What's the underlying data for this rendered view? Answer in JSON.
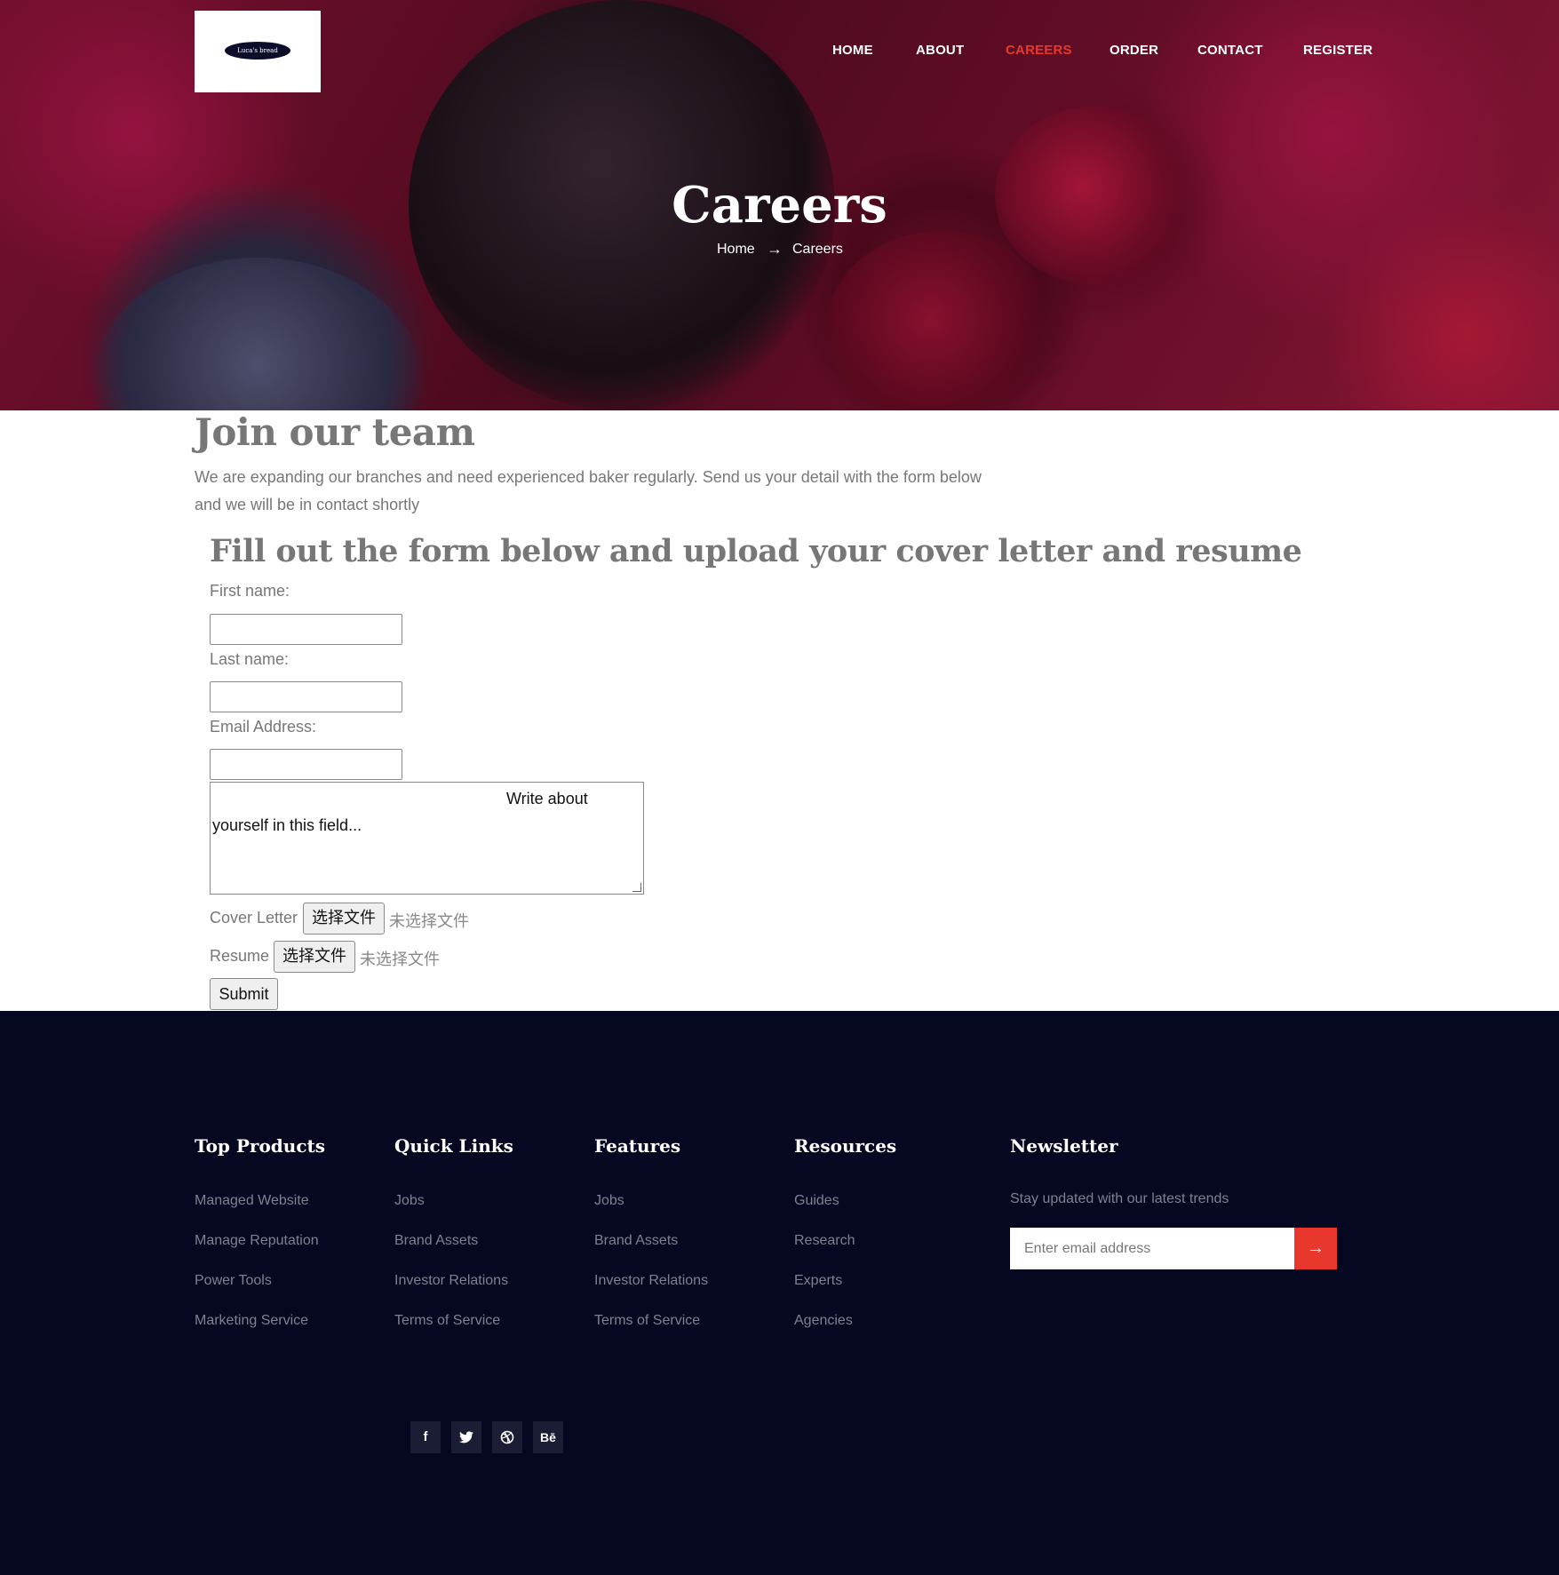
{
  "brand": {
    "logo_text": "Luca's bread"
  },
  "nav": {
    "items": [
      "HOME",
      "ABOUT",
      "CAREERS",
      "ORDER",
      "CONTACT",
      "REGISTER"
    ],
    "active": "CAREERS",
    "active_color": "#e8382e"
  },
  "hero": {
    "title": "Careers",
    "breadcrumb": {
      "home": "Home",
      "current": "Careers"
    }
  },
  "intro": {
    "heading": "Join our team",
    "text": "We are expanding our branches and need experienced baker regularly. Send us your detail with the form below and we will be in contact shortly"
  },
  "form": {
    "heading": "Fill out the form below and upload your cover letter and resume",
    "first_name_label": "First name:",
    "last_name_label": "Last name:",
    "email_label": "Email Address:",
    "about_placeholder_line1": "Write about",
    "about_placeholder_line2": "yourself in this field...",
    "cover_letter_label": "Cover Letter",
    "resume_label": "Resume",
    "choose_file": "选择文件",
    "no_file": "未选择文件",
    "submit": "Submit"
  },
  "footer": {
    "columns": [
      {
        "title": "Top Products",
        "links": [
          "Managed Website",
          "Manage Reputation",
          "Power Tools",
          "Marketing Service"
        ]
      },
      {
        "title": "Quick Links",
        "links": [
          "Jobs",
          "Brand Assets",
          "Investor Relations",
          "Terms of Service"
        ]
      },
      {
        "title": "Features",
        "links": [
          "Jobs",
          "Brand Assets",
          "Investor Relations",
          "Terms of Service"
        ]
      },
      {
        "title": "Resources",
        "links": [
          "Guides",
          "Research",
          "Experts",
          "Agencies"
        ]
      }
    ],
    "newsletter": {
      "title": "Newsletter",
      "text": "Stay updated with our latest trends",
      "placeholder": "Enter email address"
    },
    "social": [
      "facebook-icon",
      "twitter-icon",
      "dribbble-icon",
      "behance-icon"
    ],
    "accent": "#e8382e",
    "background": "#050820"
  }
}
